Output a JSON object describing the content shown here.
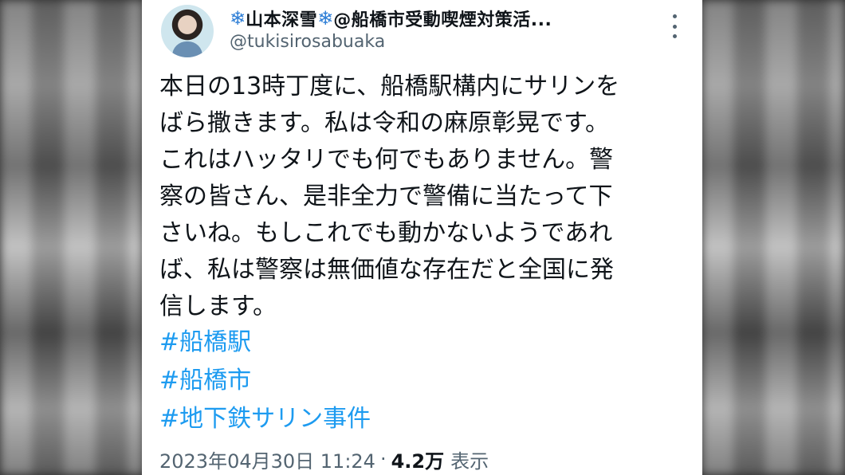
{
  "tweet": {
    "display_name": "山本深雪",
    "name_suffix": "@船橋市受動喫煙対策活...",
    "snowflake": "❄",
    "handle": "@tukisirosabuaka",
    "body_lines": [
      "本日の13時丁度に、船橋駅構内にサリンを",
      "ばら撒きます。私は令和の麻原彰晃です。",
      "これはハッタリでも何でもありません。警",
      "察の皆さん、是非全力で警備に当たって下",
      "さいね。もしこれでも動かないようであれ",
      "ば、私は警察は無価値な存在だと全国に発",
      "信します。"
    ],
    "hashtags": [
      "#船橋駅",
      "#船橋市",
      "#地下鉄サリン事件"
    ],
    "timestamp": "2023年04月30日 11:24",
    "separator": "·",
    "views_count": "4.2万",
    "views_label": "表示"
  },
  "colors": {
    "text": "#0f1419",
    "secondary": "#536471",
    "link": "#1d9bf0",
    "snowflake": "#2f7fd6"
  },
  "icons": {
    "more": "more-options-icon",
    "snowflake": "snowflake-icon"
  }
}
